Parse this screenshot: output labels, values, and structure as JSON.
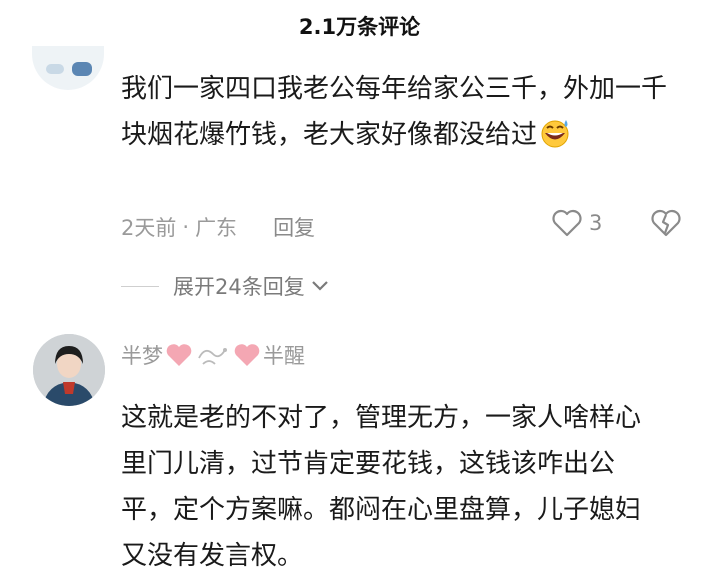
{
  "header": {
    "title": "2.1万条评论"
  },
  "comment1": {
    "text": "我们一家四口我老公每年给家公三千，外加一千块烟花爆竹钱，老大家好像都没给过",
    "emoji": "grinning-sweat-emoji",
    "time": "2天前",
    "separator": "·",
    "location": "广东",
    "reply_label": "回复",
    "like_count": "3",
    "expand_label": "展开24条回复"
  },
  "comment2": {
    "username_part1": "半梦",
    "username_part2": "半醒",
    "username_icons": [
      "heart-icon",
      "swirl-icon",
      "heart-icon"
    ],
    "text": "这就是老的不对了，管理无方，一家人啥样心里门儿清，过节肯定要花钱，这钱该咋出公平，定个方案嘛。都闷在心里盘算，儿子媳妇又没有发言权。"
  },
  "colors": {
    "heart": "#f4a7b3",
    "meta": "#9a9a9a",
    "text": "#1a1a1a"
  }
}
